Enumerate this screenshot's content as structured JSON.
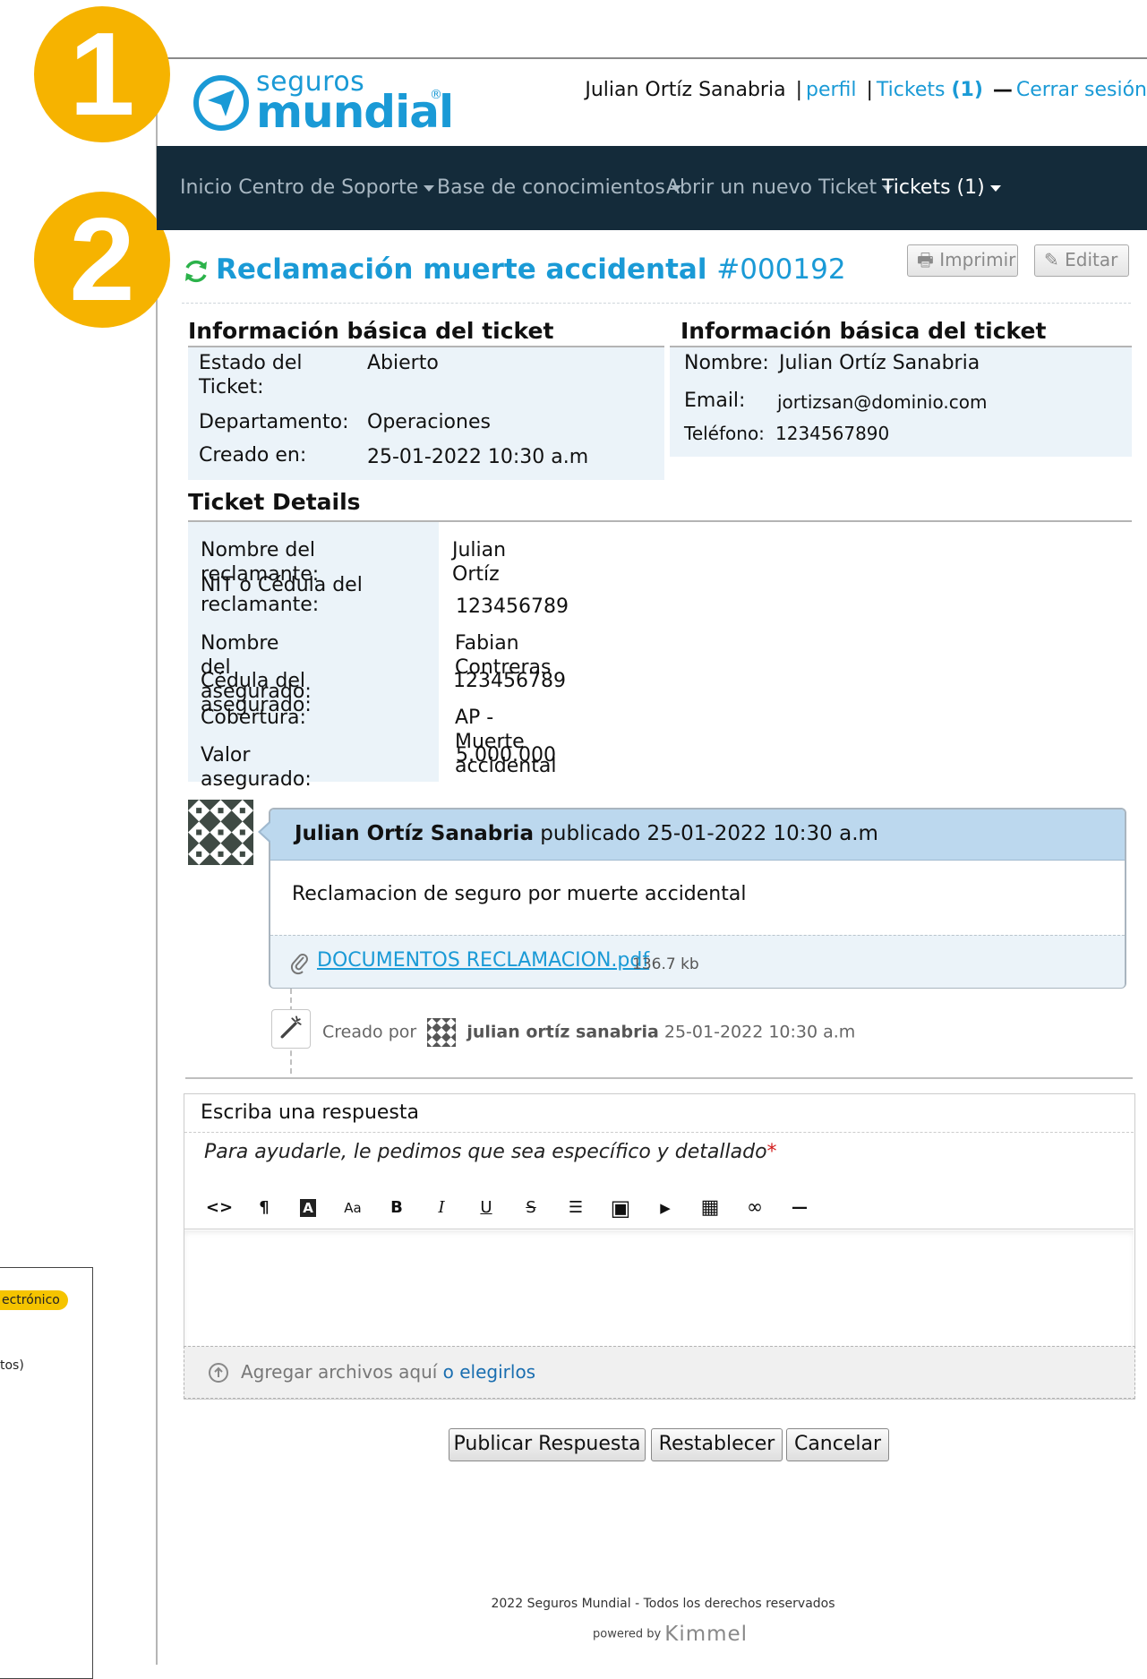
{
  "steps": [
    "1",
    "2"
  ],
  "left_panel": {
    "badge": "ectrónico",
    "fragment": "tos)"
  },
  "logo": {
    "top": "seguros",
    "main": "mundial",
    "reg": "®"
  },
  "user_bar": {
    "name": "Julian Ortíz Sanabria",
    "sep1": "|",
    "profile": "perfil",
    "sep2": "|",
    "tickets": "Tickets",
    "tickets_count": "(1)",
    "dash": "—",
    "logout": "Cerrar sesión"
  },
  "nav": {
    "items": [
      {
        "label": "Inicio Centro de Soporte"
      },
      {
        "label": "Base de conocimientos"
      },
      {
        "label": "Abrir un nuevo Ticket"
      },
      {
        "label": "Tickets (1)"
      }
    ]
  },
  "ticket": {
    "title": "Reclamación muerte accidental",
    "number": "#000192",
    "print_label": "Imprimir",
    "edit_label": "Editar"
  },
  "basic_info_left": {
    "heading": "Información básica del ticket",
    "fields": [
      {
        "label": "Estado del Ticket:",
        "value": "Abierto"
      },
      {
        "label": "Departamento:",
        "value": "Operaciones"
      },
      {
        "label": "Creado en:",
        "value": "25-01-2022 10:30 a.m"
      }
    ]
  },
  "basic_info_right": {
    "heading": "Información básica del ticket",
    "fields": [
      {
        "label": "Nombre:",
        "value": "Julian Ortíz Sanabria"
      },
      {
        "label": "Email:",
        "value": "jortizsan@dominio.com"
      },
      {
        "label": "Teléfono:",
        "value": "1234567890"
      }
    ]
  },
  "details": {
    "heading": "Ticket Details",
    "fields": [
      {
        "label": "Nombre del reclamante:",
        "value": "Julian Ortíz"
      },
      {
        "label": "NIT o Cédula del reclamante:",
        "value": "123456789"
      },
      {
        "label": "Nombre del asegurado:",
        "value": "Fabian Contreras"
      },
      {
        "label": "Cédula del asegurado:",
        "value": "123456789"
      },
      {
        "label": "Cobertura:",
        "value": "AP - Muerte accidental"
      },
      {
        "label": "Valor asegurado:",
        "value": "5.000.000"
      }
    ]
  },
  "post": {
    "author": "Julian Ortíz Sanabria",
    "published": "publicado 25-01-2022 10:30 a.m",
    "body": "Reclamacion de seguro por muerte accidental",
    "attachment_name": "DOCUMENTOS RECLAMACION.pdf",
    "attachment_size": "136.7 kb"
  },
  "event": {
    "prefix": "Creado por",
    "user": "julian ortíz sanabria",
    "date": "25-01-2022 10:30 a.m"
  },
  "reply": {
    "label": "Escriba una respuesta",
    "hint": "Para ayudarle, le pedimos que sea específico y detallado",
    "required_mark": "*",
    "drop_text": "Agregar archivos aquí",
    "drop_link": "o elegirlos"
  },
  "toolbar": [
    {
      "name": "code-view-icon",
      "glyph": "<>"
    },
    {
      "name": "paragraph-icon",
      "glyph": "¶"
    },
    {
      "name": "font-color-icon",
      "glyph": "A"
    },
    {
      "name": "font-size-icon",
      "glyph": "Aa"
    },
    {
      "name": "bold-icon",
      "glyph": "B"
    },
    {
      "name": "italic-icon",
      "glyph": "I"
    },
    {
      "name": "underline-icon",
      "glyph": "U"
    },
    {
      "name": "strikethrough-icon",
      "glyph": "S"
    },
    {
      "name": "list-icon",
      "glyph": "☰"
    },
    {
      "name": "image-icon",
      "glyph": "▣"
    },
    {
      "name": "video-icon",
      "glyph": "▶"
    },
    {
      "name": "table-icon",
      "glyph": "▦"
    },
    {
      "name": "link-icon",
      "glyph": "∞"
    },
    {
      "name": "horizontal-rule-icon",
      "glyph": "—"
    }
  ],
  "actions": {
    "post": "Publicar Respuesta",
    "reset": "Restablecer",
    "cancel": "Cancelar"
  },
  "footer": {
    "text": "2022 Seguros Mundial - Todos los derechos reservados",
    "powered": "powered by",
    "brand": "Kimmel"
  },
  "colors": {
    "brand": "#1a9ad6",
    "navbar": "#142b3a",
    "step_badge": "#f6b300",
    "info_bg": "#ebf3f9",
    "post_header": "#bcd8ee",
    "refresh": "#2bb24a"
  }
}
